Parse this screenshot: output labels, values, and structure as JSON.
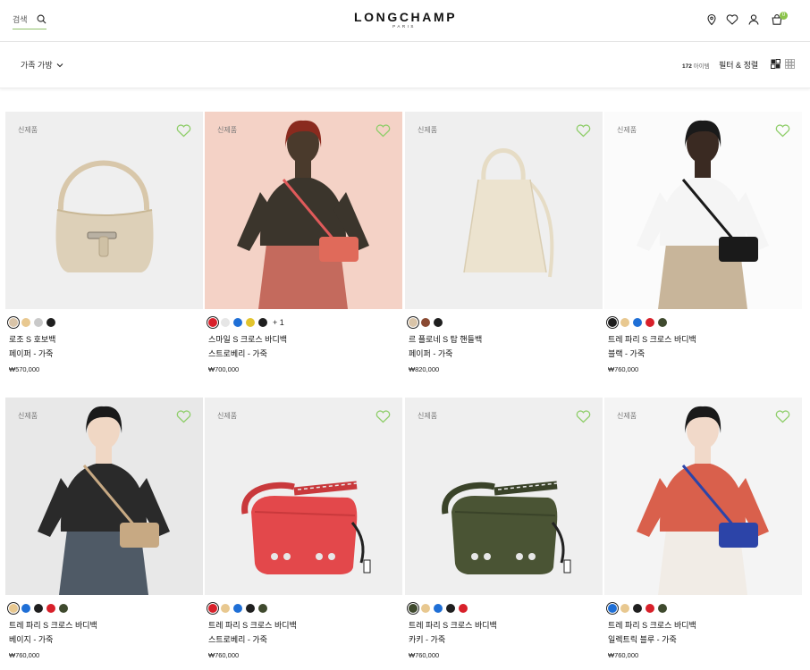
{
  "header": {
    "search_label": "검색",
    "logo": "LONGCHAMP",
    "logo_sub": "PARIS",
    "cart_count": "0"
  },
  "filters": {
    "family": "가족 가방",
    "count_number": "172",
    "count_label": "아이템",
    "filter_sort": "필터 & 정렬"
  },
  "products": [
    {
      "badge": "신제품",
      "name": "로조 S 호보백",
      "color": "페이퍼 - 가죽",
      "price": "₩570,000",
      "swatches": [
        "#d9c4a8",
        "#e8c890",
        "#c9c9c9",
        "#1f1f1f"
      ],
      "selected": 0,
      "more": "",
      "bag": "hobo-beige"
    },
    {
      "badge": "신제품",
      "name": "스마일 S 크로스 바디백",
      "color": "스트로베리 - 가죽",
      "price": "₩700,000",
      "swatches": [
        "#d8202a",
        "#e6e6e6",
        "#1f6fd6",
        "#e2c42d",
        "#1f1f1f"
      ],
      "selected": 0,
      "more": "+ 1",
      "bag": "model-1"
    },
    {
      "badge": "신제품",
      "name": "르 플로네 S 탑 핸들백",
      "color": "페이퍼 - 가죽",
      "price": "₩820,000",
      "swatches": [
        "#d9c4a8",
        "#8a4a32",
        "#1f1f1f"
      ],
      "selected": 0,
      "more": "",
      "bag": "tote-cream"
    },
    {
      "badge": "신제품",
      "name": "트레 파리 S 크로스 바디백",
      "color": "블랙 - 가죽",
      "price": "₩760,000",
      "swatches": [
        "#1f1f1f",
        "#e8c890",
        "#1f6fd6",
        "#d8202a",
        "#3f4a2e"
      ],
      "selected": 0,
      "more": "",
      "bag": "model-2"
    },
    {
      "badge": "신제품",
      "name": "트레 파리 S 크로스 바디백",
      "color": "베이지 - 가죽",
      "price": "₩760,000",
      "swatches": [
        "#e8c890",
        "#1f6fd6",
        "#1f1f1f",
        "#d8202a",
        "#3f4a2e"
      ],
      "selected": 0,
      "more": "",
      "bag": "model-3"
    },
    {
      "badge": "신제품",
      "name": "트레 파리 S 크로스 바디백",
      "color": "스트로베리 - 가죽",
      "price": "₩760,000",
      "swatches": [
        "#d8202a",
        "#e8c890",
        "#1f6fd6",
        "#1f1f1f",
        "#3f4a2e"
      ],
      "selected": 0,
      "more": "",
      "bag": "flap-red"
    },
    {
      "badge": "신제품",
      "name": "트레 파리 S 크로스 바디백",
      "color": "카키 - 가죽",
      "price": "₩760,000",
      "swatches": [
        "#3f4a2e",
        "#e8c890",
        "#1f6fd6",
        "#1f1f1f",
        "#d8202a"
      ],
      "selected": 0,
      "more": "",
      "bag": "flap-khaki"
    },
    {
      "badge": "신제품",
      "name": "트레 파리 S 크로스 바디백",
      "color": "일렉트릭 블루 - 가죽",
      "price": "₩760,000",
      "swatches": [
        "#1f6fd6",
        "#e8c890",
        "#1f1f1f",
        "#d8202a",
        "#3f4a2e"
      ],
      "selected": 0,
      "more": "",
      "bag": "model-4"
    }
  ]
}
